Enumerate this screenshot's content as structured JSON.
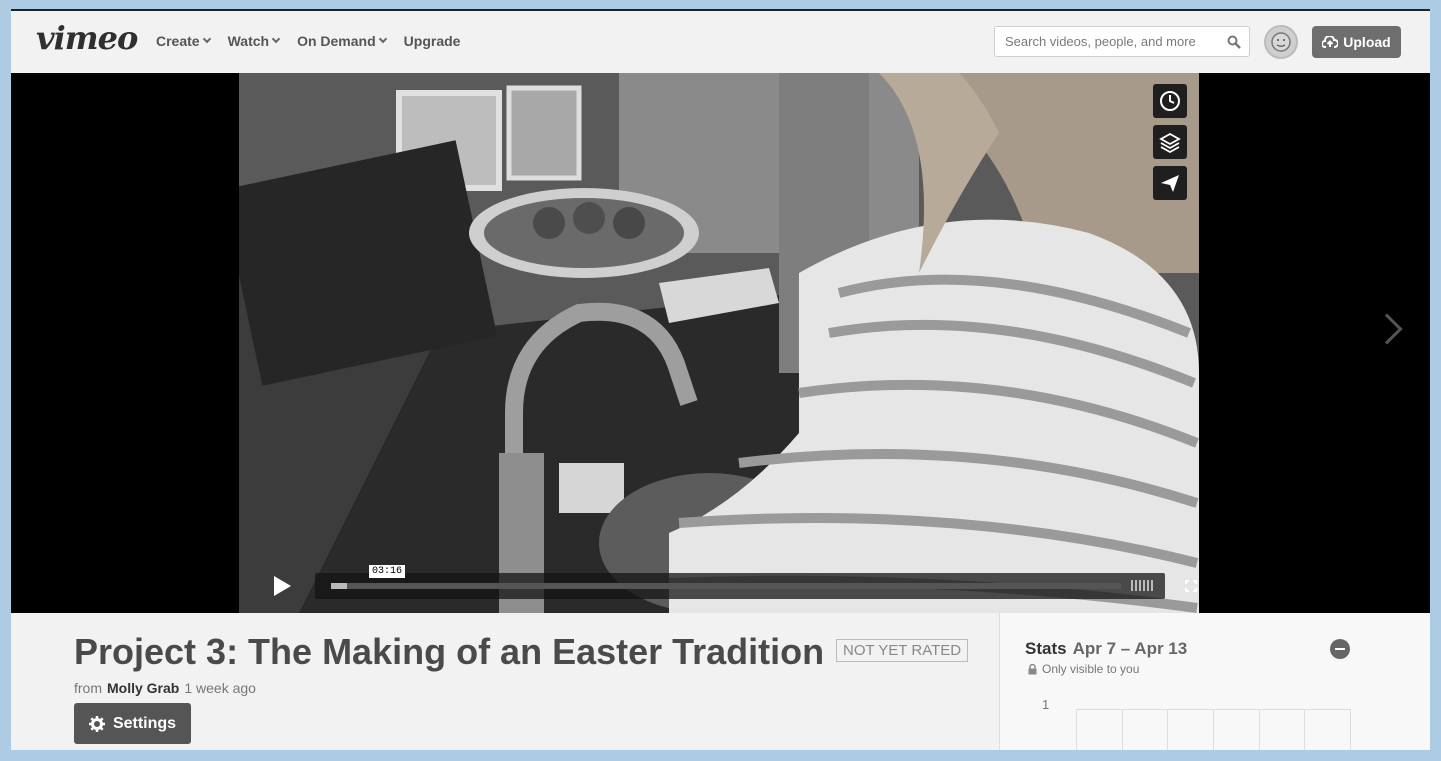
{
  "header": {
    "logo": "vimeo",
    "nav": [
      {
        "label": "Create"
      },
      {
        "label": "Watch"
      },
      {
        "label": "On Demand"
      },
      {
        "label": "Upgrade"
      }
    ],
    "search_placeholder": "Search videos, people, and more",
    "upload_label": "Upload"
  },
  "player": {
    "timecode": "03:16",
    "progress": 0.02
  },
  "video": {
    "title": "Project 3: The Making of an Easter Tradition",
    "rating_badge": "NOT YET RATED",
    "from_label": "from",
    "author": "Molly Grab",
    "age": "1 week ago",
    "settings_label": "Settings"
  },
  "stats": {
    "label": "Stats",
    "range": "Apr 7 – Apr 13",
    "privacy": "Only visible to you",
    "y_axis_top": "1"
  }
}
